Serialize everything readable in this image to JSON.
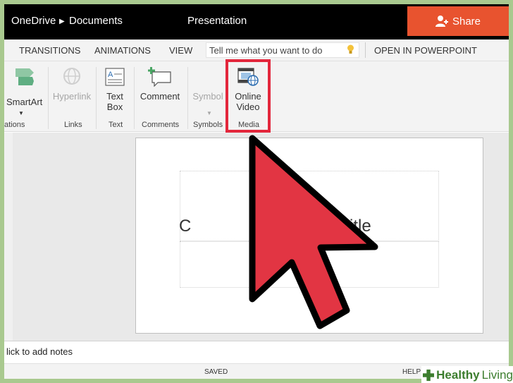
{
  "topbar": {
    "app": "OneDrive",
    "folder": "Documents",
    "file_name": "Presentation",
    "share_label": "Share"
  },
  "tabs": {
    "transitions": "TRANSITIONS",
    "animations": "ANIMATIONS",
    "view": "VIEW",
    "tell_me_placeholder": "Tell me what you want to do",
    "open_in": "OPEN IN POWERPOINT"
  },
  "ribbon": {
    "smartart": "SmartArt",
    "hyperlink": "Hyperlink",
    "textbox_1": "Text",
    "textbox_2": "Box",
    "comment": "Comment",
    "symbol": "Symbol",
    "online_video_1": "Online",
    "online_video_2": "Video",
    "groups": {
      "illustrations": "ations",
      "links": "Links",
      "text": "Text",
      "comments": "Comments",
      "symbols": "Symbols",
      "media": "Media"
    }
  },
  "slide": {
    "title_left": "C",
    "title_right": "itle"
  },
  "notes": {
    "placeholder": "lick to add notes"
  },
  "status": {
    "saved": "SAVED",
    "help": "HELP"
  },
  "watermark": {
    "bold": "Healthy",
    "light": "Living"
  },
  "colors": {
    "share": "#e8532f",
    "highlight": "#e3273c",
    "cursor": "#e23543",
    "watermark": "#3c7d2e"
  }
}
